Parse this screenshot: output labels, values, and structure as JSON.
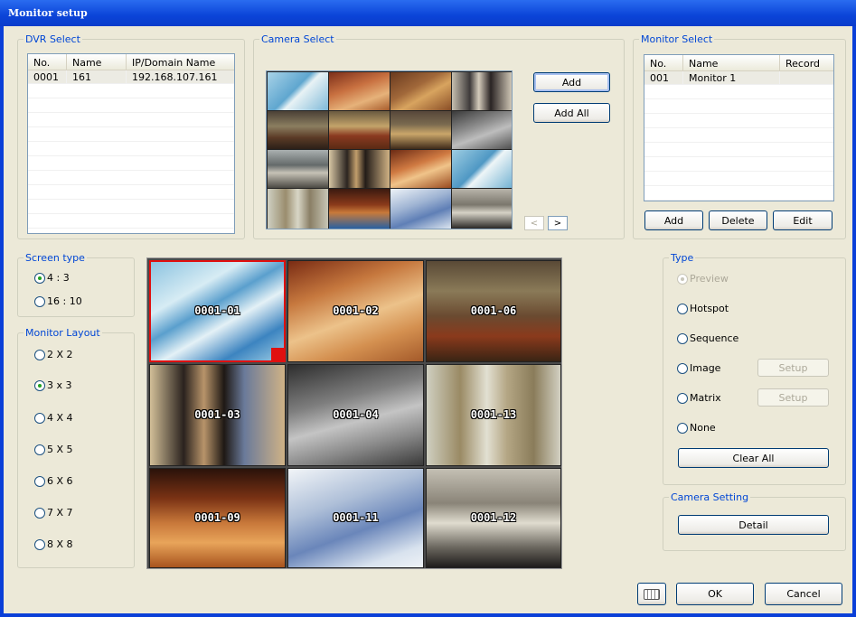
{
  "window": {
    "title": "Monitor setup"
  },
  "dvr_select": {
    "legend": "DVR Select",
    "columns": [
      "No.",
      "Name",
      "IP/Domain Name"
    ],
    "rows": [
      [
        "0001",
        "161",
        "192.168.107.161"
      ]
    ]
  },
  "camera_select": {
    "legend": "Camera Select",
    "add_label": "Add",
    "add_all_label": "Add All",
    "prev_label": "<",
    "next_label": ">"
  },
  "monitor_select": {
    "legend": "Monitor Select",
    "columns": [
      "No.",
      "Name",
      "Record"
    ],
    "rows": [
      [
        "001",
        "Monitor 1",
        ""
      ]
    ],
    "add_label": "Add",
    "delete_label": "Delete",
    "edit_label": "Edit"
  },
  "screen_type": {
    "legend": "Screen type",
    "options": [
      "4 : 3",
      "16 : 10"
    ],
    "selected": 0
  },
  "monitor_layout": {
    "legend": "Monitor Layout",
    "options": [
      "2 X 2",
      "3 x 3",
      "4 X 4",
      "5 X 5",
      "6 X 6",
      "7 X 7",
      "8 X 8"
    ],
    "selected": 1
  },
  "grid": {
    "tiles": [
      "0001-01",
      "0001-02",
      "0001-06",
      "0001-03",
      "0001-04",
      "0001-13",
      "0001-09",
      "0001-11",
      "0001-12"
    ]
  },
  "type": {
    "legend": "Type",
    "preview_label": "Preview",
    "hotspot_label": "Hotspot",
    "sequence_label": "Sequence",
    "image_label": "Image",
    "matrix_label": "Matrix",
    "none_label": "None",
    "setup_label": "Setup",
    "clear_all_label": "Clear All"
  },
  "camera_setting": {
    "legend": "Camera Setting",
    "detail_label": "Detail"
  },
  "footer": {
    "ok_label": "OK",
    "cancel_label": "Cancel"
  },
  "colors": {
    "title_bar": "#0b44d8",
    "legend_text": "#0046d5",
    "dialog_bg": "#ece9d8",
    "selected_tile_border": "#e01010"
  }
}
